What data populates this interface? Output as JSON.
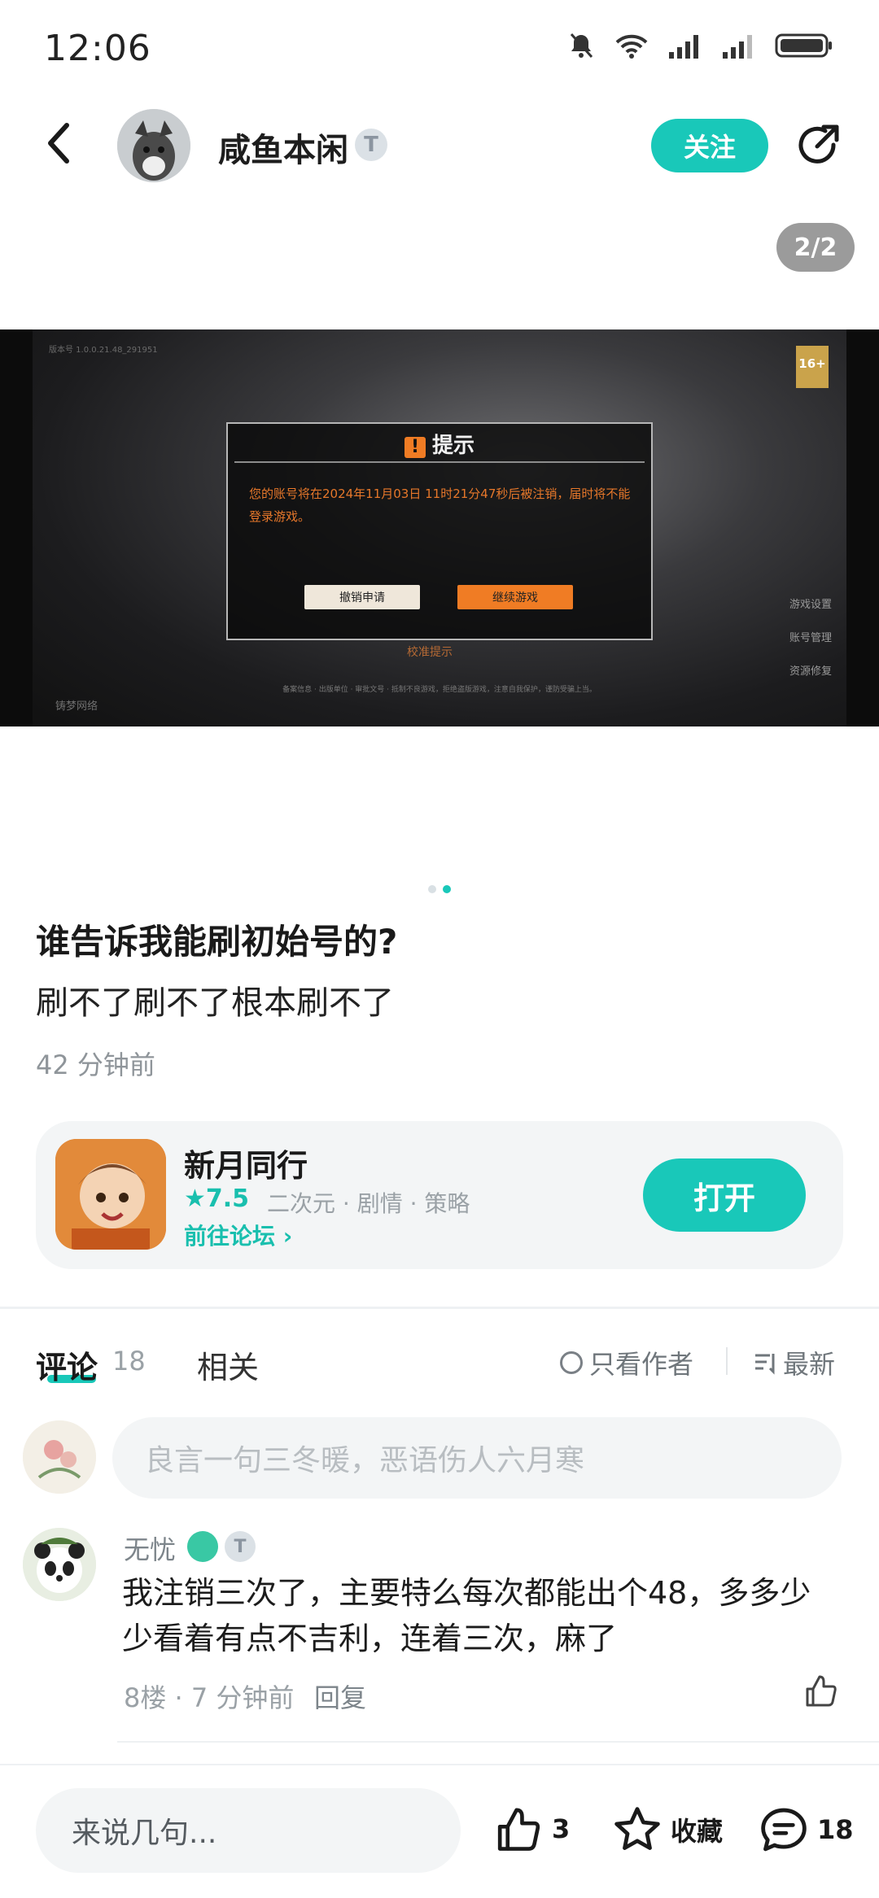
{
  "status_bar": {
    "time": "12:06"
  },
  "header": {
    "username": "咸鱼本闲",
    "level_badge": "T",
    "follow_label": "关注"
  },
  "gallery": {
    "page_indicator": "2/2",
    "current": 2,
    "total": 2
  },
  "screenshot_content": {
    "dialog_title": "提示",
    "dialog_message": "您的账号将在2024年11月03日 11时21分47秒后被注销，届时将不能登录游戏。",
    "cancel_button": "撤销申请",
    "continue_button": "继续游戏",
    "age_rating": "16+",
    "side_menu": [
      "游戏设置",
      "账号管理",
      "资源修复"
    ]
  },
  "post": {
    "title": "谁告诉我能刷初始号的?",
    "body": "刷不了刷不了根本刷不了",
    "time": "42 分钟前"
  },
  "game_card": {
    "name": "新月同行",
    "rating": "★7.5",
    "tags": "二次元 · 剧情 · 策略",
    "forum_link": "前往论坛 ›",
    "open_label": "打开"
  },
  "tabs": {
    "comments_label": "评论",
    "comments_count": "18",
    "related_label": "相关",
    "only_author": "只看作者",
    "sort_label": "最新"
  },
  "comment_input": {
    "placeholder": "良言一句三冬暖，恶语伤人六月寒"
  },
  "comments": [
    {
      "name": "无忧",
      "badge": "T",
      "text": "我注销三次了，主要特么每次都能出个48，多多少少看着有点不吉利，连着三次，麻了",
      "meta": "8楼 · 7 分钟前",
      "reply": "回复"
    }
  ],
  "bottom_bar": {
    "input_placeholder": "来说几句...",
    "likes": "3",
    "favorite_label": "收藏",
    "comments": "18"
  },
  "colors": {
    "accent": "#19c8b9",
    "text": "#1a1a1a",
    "muted": "#9aa1a6"
  }
}
